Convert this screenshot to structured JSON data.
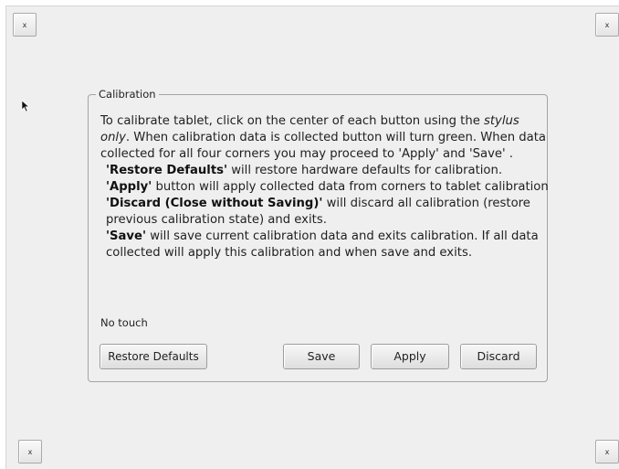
{
  "corner_buttons": {
    "top_left": "x",
    "top_right": "x",
    "bottom_left": "x",
    "bottom_right": "x"
  },
  "calibration": {
    "legend": "Calibration",
    "intro": {
      "part1": "To calibrate tablet, click on the center of each button using the ",
      "stylus_only": "stylus only",
      "part2": ". When calibration data is collected  button will turn green. When data collected for all four corners you may proceed to 'Apply' and 'Save' ."
    },
    "restore_line": {
      "bold": "'Restore Defaults'",
      "text": " will restore hardware defaults for calibration."
    },
    "apply_line": {
      "bold": "'Apply'",
      "text": " button will apply collected data from corners to tablet calibration"
    },
    "discard_line": {
      "bold": "'Discard (Close without Saving)'",
      "text": " will discard all calibration (restore previous calibration state) and exits."
    },
    "save_line": {
      "bold": "'Save'",
      "text": " will save current calibration data and exits calibration. If all data collected will apply this calibration and when save and exits."
    },
    "touch_status": "No touch",
    "buttons": {
      "restore": "Restore Defaults",
      "save": "Save",
      "apply": "Apply",
      "discard": "Discard"
    }
  }
}
